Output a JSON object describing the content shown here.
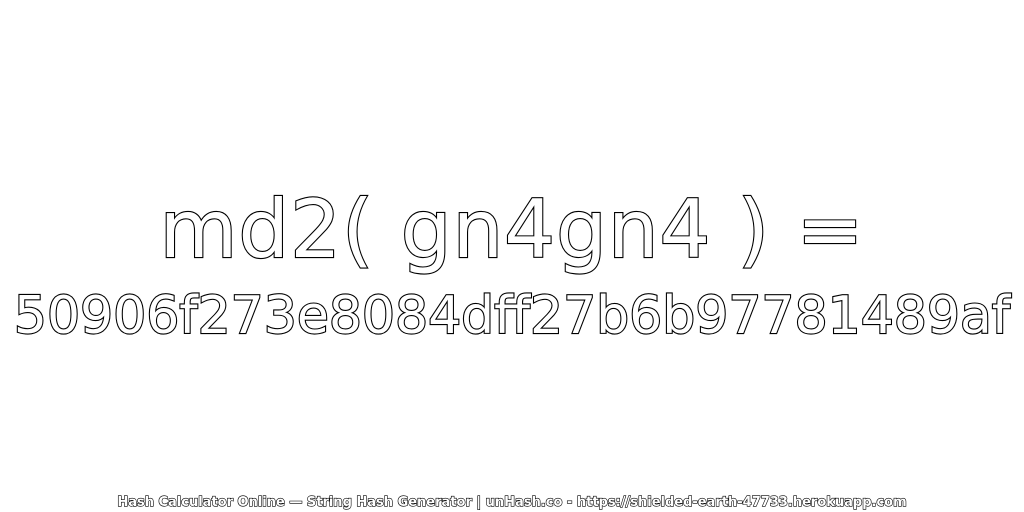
{
  "expression": "md2( gn4gn4 ) =",
  "hash": "50906f273e8084dff27b6b97781489af",
  "footer": "Hash Calculator Online — String Hash Generator | unHash.co - https://shielded-earth-47733.herokuapp.com"
}
